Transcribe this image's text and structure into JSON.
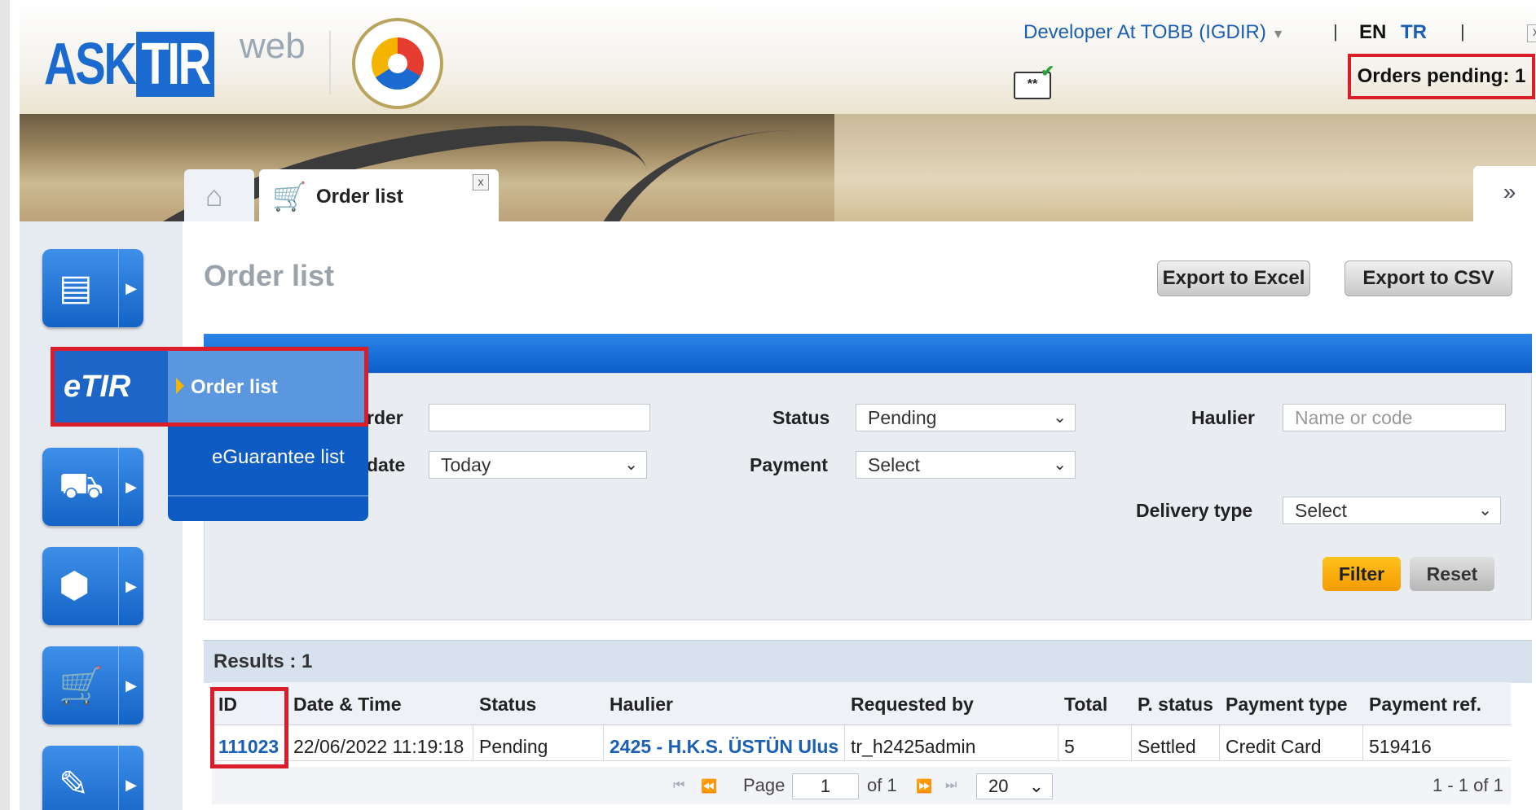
{
  "header": {
    "logo_ask": "ASK",
    "logo_tir": "TIR",
    "logo_web": "web",
    "user_menu": "Developer At TOBB (IGDIR)",
    "lang_en": "EN",
    "lang_tr": "TR",
    "separator": "|",
    "close": "x",
    "cert_text": "**",
    "orders_pending": "Orders pending: 1"
  },
  "tabs": {
    "home_icon": "home-icon",
    "order_list": "Order list",
    "close": "x"
  },
  "sidebar": {
    "items": [
      {
        "icon": "documents-icon"
      },
      {
        "icon": "etir-icon",
        "label": "eTIR"
      },
      {
        "icon": "truck-icon"
      },
      {
        "icon": "box-icon"
      },
      {
        "icon": "cart-icon"
      },
      {
        "icon": "stamp-icon"
      }
    ],
    "submenu": {
      "active": "Order list",
      "items": [
        "Order list",
        "eGuarantee list"
      ]
    }
  },
  "main": {
    "title": "Order list",
    "export_excel": "Export to Excel",
    "export_csv": "Export to CSV",
    "filter": {
      "labels": {
        "order": "rder",
        "date": "date",
        "status": "Status",
        "payment": "Payment",
        "haulier": "Haulier",
        "delivery_type": "Delivery type"
      },
      "values": {
        "order": "",
        "date": "Today",
        "status": "Pending",
        "payment": "Select",
        "delivery_type": "Select"
      },
      "placeholders": {
        "haulier": "Name or code"
      },
      "filter_button": "Filter",
      "reset_button": "Reset"
    },
    "results_label": "Results : 1",
    "table": {
      "columns": [
        "ID",
        "Date & Time",
        "Status",
        "Haulier",
        "Requested by",
        "Total",
        "P. status",
        "Payment type",
        "Payment ref."
      ],
      "rows": [
        [
          "111023",
          "22/06/2022 11:19:18",
          "Pending",
          "2425 - H.K.S. ÜSTÜN Ulus",
          "tr_h2425admin",
          "5",
          "Settled",
          "Credit Card",
          "519416"
        ]
      ]
    },
    "pager": {
      "first": "⏮",
      "prev": "⏪",
      "page_label": "Page",
      "page": "1",
      "of": "of 1",
      "next": "⏩",
      "last": "⏭",
      "page_size": "20",
      "summary": "1 - 1 of 1"
    }
  },
  "colors": {
    "brand_blue": "#1a6ad0",
    "highlight_red": "#d91e2a",
    "filter_orange": "#f5b400"
  }
}
